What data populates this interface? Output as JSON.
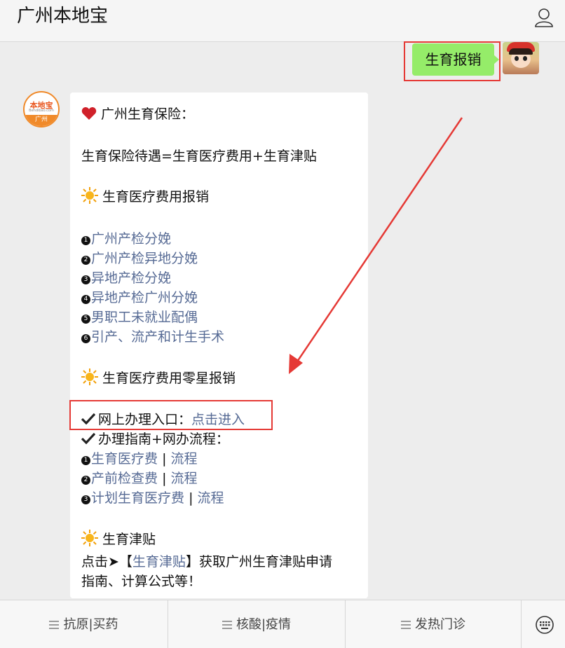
{
  "header": {
    "title": "广州本地宝"
  },
  "outgoing": {
    "text": "生育报销"
  },
  "incoming": {
    "heading": "广州生育保险：",
    "formula": "生育保险待遇=生育医疗费用+生育津贴",
    "section1": "生育医疗费用报销",
    "list1": [
      {
        "num": "1",
        "text": "广州产检分娩"
      },
      {
        "num": "2",
        "text": "广州产检异地分娩"
      },
      {
        "num": "3",
        "text": "异地产检分娩"
      },
      {
        "num": "4",
        "text": "异地产检广州分娩"
      },
      {
        "num": "5",
        "text": "男职工未就业配偶"
      },
      {
        "num": "6",
        "text": "引产、流产和计生手术"
      }
    ],
    "section2": "生育医疗费用零星报销",
    "online_label": "网上办理入口：",
    "online_link": "点击进入",
    "guide_label": "办理指南+网办流程：",
    "list2": [
      {
        "num": "1",
        "text": "生育医疗费",
        "link": "流程"
      },
      {
        "num": "2",
        "text": "产前检查费",
        "link": "流程"
      },
      {
        "num": "3",
        "text": "计划生育医疗费",
        "link": "流程"
      }
    ],
    "separator": "|",
    "section3": "生育津贴",
    "allowance_prefix": "点击➤【",
    "allowance_link": "生育津贴",
    "allowance_suffix": "】获取广州生育津贴申请",
    "allowance_line2": "指南、计算公式等！"
  },
  "bot_logo": {
    "top": "本地宝",
    "mid": "Bendibao.com",
    "bottom": "广州"
  },
  "menu": [
    {
      "label": "抗原|买药"
    },
    {
      "label": "核酸|疫情"
    },
    {
      "label": "发热门诊"
    }
  ],
  "colors": {
    "highlight": "#e53935",
    "link": "#576b95",
    "bubble_out": "#95ec69"
  }
}
